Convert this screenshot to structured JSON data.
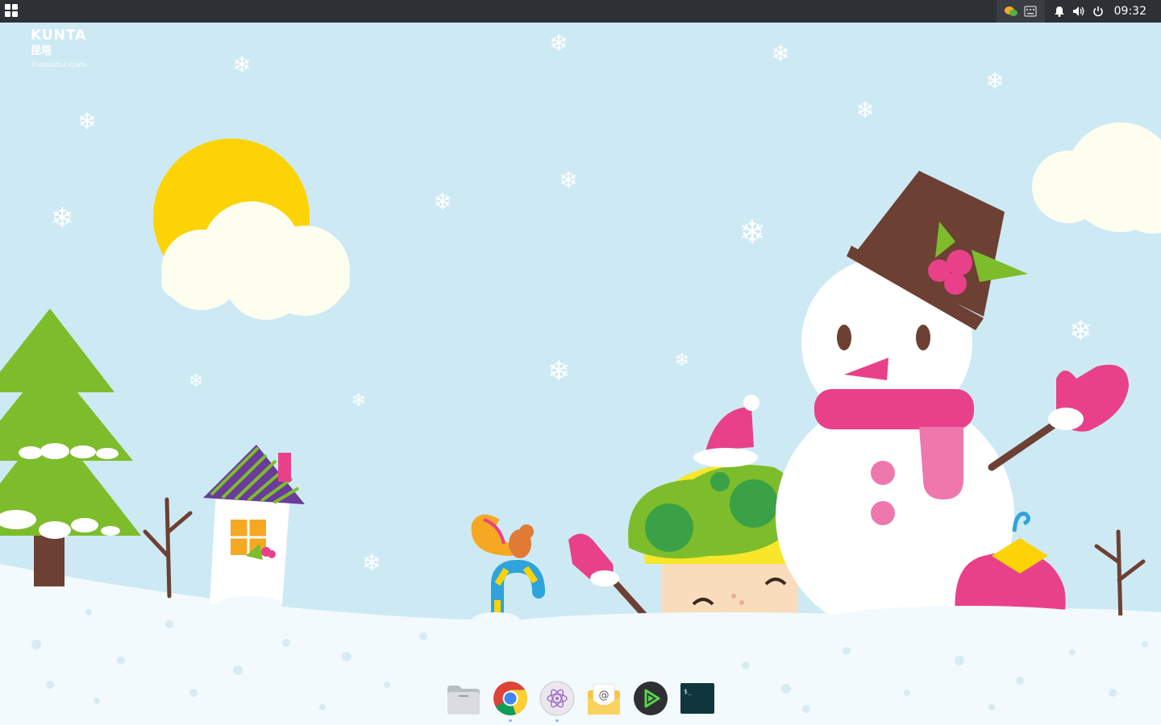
{
  "topbar": {
    "clock": "09:32",
    "launcher_icon": "app-grid-icon",
    "tray_icons": [
      "wechat-icon",
      "keyboard-icon",
      "notification-bell-icon",
      "volume-icon",
      "power-icon"
    ]
  },
  "wallpaper": {
    "logo_main": "KUNTA",
    "logo_sub": "昆塔",
    "logo_tag": "©VERSATILE KUNTA"
  },
  "dock": {
    "items": [
      {
        "name": "file-manager",
        "icon": "folder-icon",
        "running": false
      },
      {
        "name": "chrome",
        "icon": "chrome-icon",
        "running": true
      },
      {
        "name": "atom",
        "icon": "atom-icon",
        "running": true
      },
      {
        "name": "mail",
        "icon": "mail-icon",
        "running": false
      },
      {
        "name": "deepin-music",
        "icon": "music-player-icon",
        "running": false
      },
      {
        "name": "terminal",
        "icon": "terminal-icon",
        "running": false
      }
    ],
    "terminal_prompt": "$_"
  },
  "colors": {
    "sky": "#cdeaf4",
    "snow": "#f3fafd",
    "topbar": "#2d3035",
    "pink": "#e8418a",
    "green": "#7dbd2c",
    "sun": "#fcd304",
    "hat": "#6d4034"
  }
}
